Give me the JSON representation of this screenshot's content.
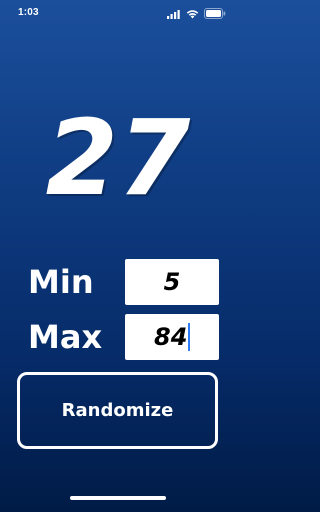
{
  "status_bar": {
    "time": "1:03",
    "icons": [
      "signal-icon",
      "wifi-icon",
      "battery-icon"
    ]
  },
  "result": {
    "value": "27"
  },
  "range": {
    "min_label": "Min",
    "min_value": "5",
    "max_label": "Max",
    "max_value": "84"
  },
  "actions": {
    "randomize_label": "Randomize"
  },
  "colors": {
    "background_top": "#1b4f9c",
    "background_bottom": "#001b46",
    "text": "#ffffff",
    "input_bg": "#ffffff",
    "caret": "#2b7cff"
  }
}
